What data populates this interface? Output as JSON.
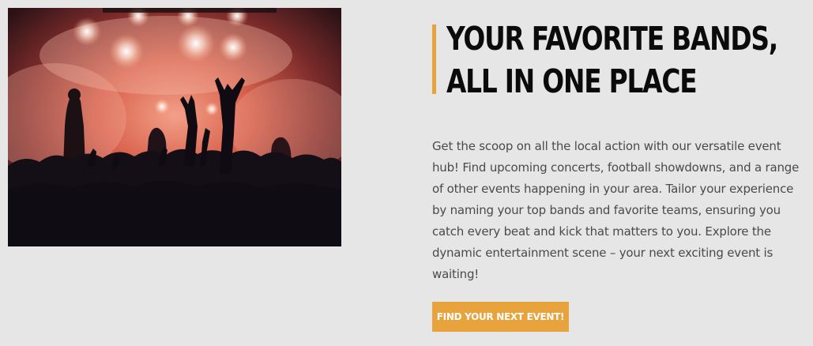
{
  "image": {
    "description_icon": "concert-photo"
  },
  "headline": {
    "line1": "YOUR FAVORITE BANDS,",
    "line2": "ALL IN ONE PLACE"
  },
  "body": {
    "text": "Get the scoop on all the local action with our versatile event hub! Find upcoming concerts, football showdowns, and a range of other events happening in your area. Tailor your experience by naming your top bands and favorite teams, ensuring you catch every beat and kick that matters to you. Explore the dynamic entertainment scene – your next exciting event is waiting!"
  },
  "cta": {
    "label": "FIND YOUR NEXT EVENT!"
  },
  "colors": {
    "background": "#e6e6e6",
    "accent": "#e8a33d",
    "heading": "#0b0b0b",
    "body": "#4a4a4a"
  }
}
